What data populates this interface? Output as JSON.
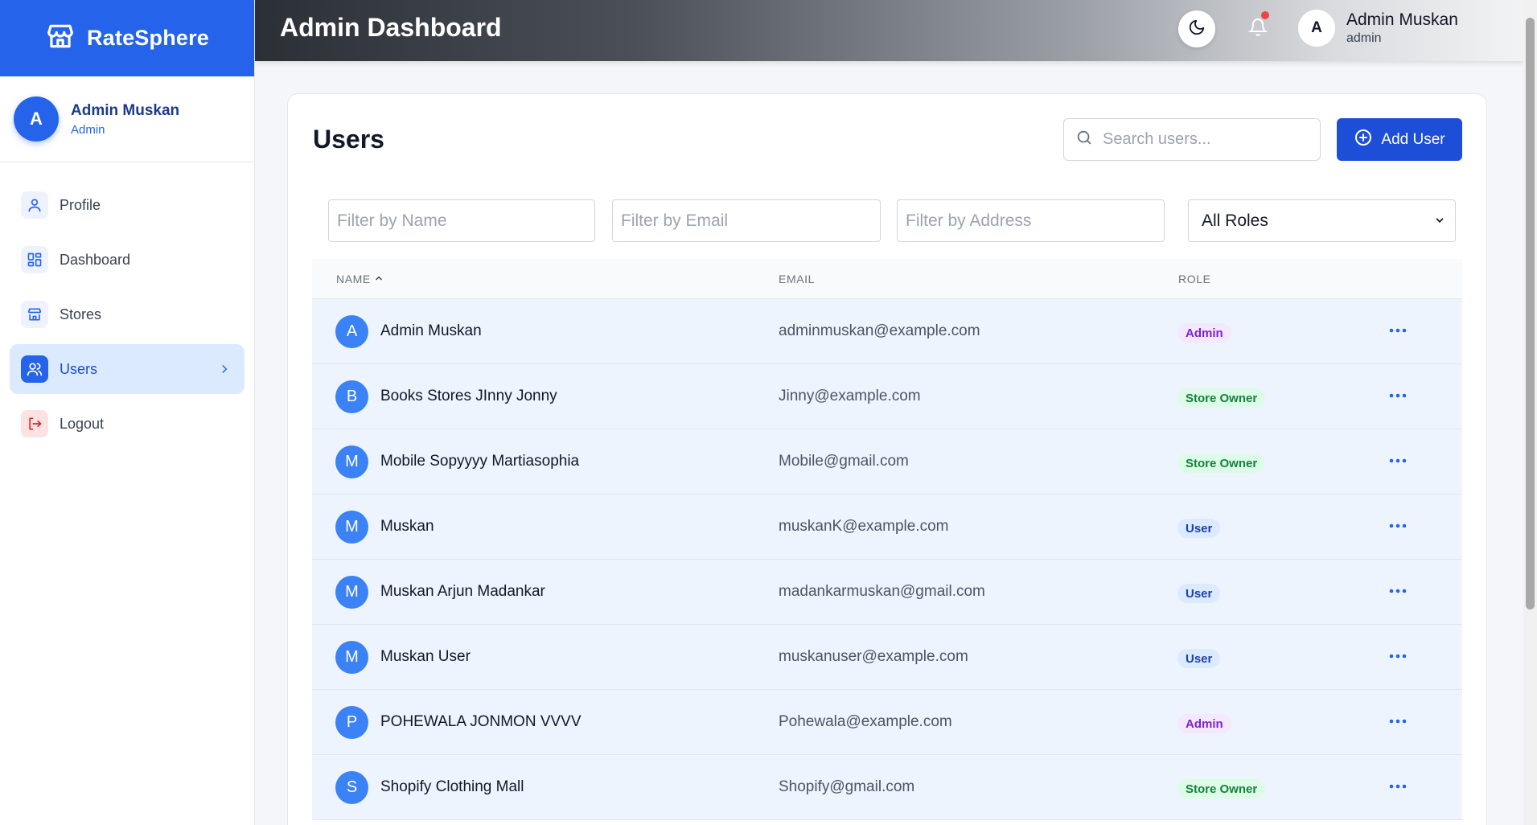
{
  "brand": {
    "name": "RateSphere"
  },
  "sidebar": {
    "profile": {
      "initial": "A",
      "name": "Admin Muskan",
      "role": "Admin"
    },
    "items": [
      {
        "label": "Profile",
        "icon": "user-icon"
      },
      {
        "label": "Dashboard",
        "icon": "grid-icon"
      },
      {
        "label": "Stores",
        "icon": "store-icon"
      },
      {
        "label": "Users",
        "icon": "users-icon",
        "active": true
      },
      {
        "label": "Logout",
        "icon": "logout-icon"
      }
    ]
  },
  "header": {
    "title": "Admin Dashboard",
    "user": {
      "initial": "A",
      "name": "Admin Muskan",
      "role": "admin"
    }
  },
  "main": {
    "title": "Users",
    "search_placeholder": "Search users...",
    "add_label": "Add User",
    "filters": {
      "name_placeholder": "Filter by Name",
      "email_placeholder": "Filter by Email",
      "address_placeholder": "Filter by Address",
      "role_selected": "All Roles"
    },
    "columns": {
      "name": "NAME",
      "email": "EMAIL",
      "role": "ROLE"
    },
    "rows": [
      {
        "initial": "A",
        "name": "Admin Muskan",
        "email": "adminmuskan@example.com",
        "role": "Admin"
      },
      {
        "initial": "B",
        "name": "Books Stores JInny Jonny",
        "email": "Jinny@example.com",
        "role": "Store Owner"
      },
      {
        "initial": "M",
        "name": "Mobile Sopyyyy Martiasophia",
        "email": "Mobile@gmail.com",
        "role": "Store Owner"
      },
      {
        "initial": "M",
        "name": "Muskan",
        "email": "muskanK@example.com",
        "role": "User"
      },
      {
        "initial": "M",
        "name": "Muskan Arjun Madankar",
        "email": "madankarmuskan@gmail.com",
        "role": "User"
      },
      {
        "initial": "M",
        "name": "Muskan User",
        "email": "muskanuser@example.com",
        "role": "User"
      },
      {
        "initial": "P",
        "name": "POHEWALA JONMON VVVV",
        "email": "Pohewala@example.com",
        "role": "Admin"
      },
      {
        "initial": "S",
        "name": "Shopify Clothing Mall",
        "email": "Shopify@gmail.com",
        "role": "Store Owner"
      }
    ]
  },
  "colors": {
    "accent": "#2563eb",
    "admin_badge": "#7e22ce",
    "owner_badge": "#15803d",
    "user_badge": "#1e40af"
  }
}
